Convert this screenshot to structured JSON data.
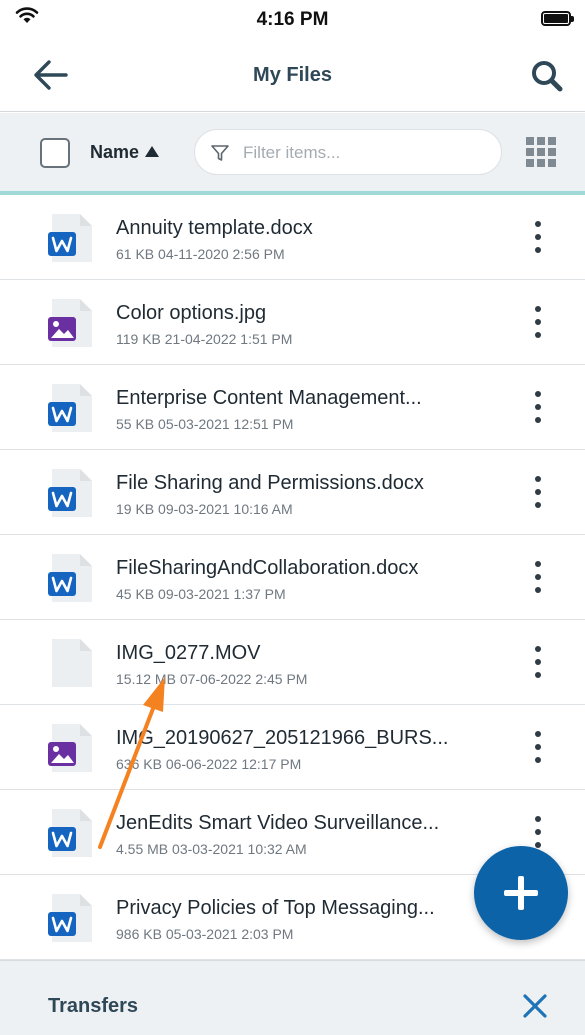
{
  "status_bar": {
    "time": "4:16 PM"
  },
  "header": {
    "title": "My Files"
  },
  "toolbar": {
    "sort_label": "Name",
    "filter_placeholder": "Filter items..."
  },
  "files": [
    {
      "name": "Annuity template.docx",
      "meta": "61 KB 04-11-2020 2:56 PM",
      "icon": "word-doc-icon"
    },
    {
      "name": "Color options.jpg",
      "meta": "119 KB 21-04-2022 1:51 PM",
      "icon": "image-file-icon"
    },
    {
      "name": "Enterprise Content Management...",
      "meta": "55 KB 05-03-2021 12:51 PM",
      "icon": "word-doc-icon"
    },
    {
      "name": "File Sharing and Permissions.docx",
      "meta": "19 KB 09-03-2021 10:16 AM",
      "icon": "word-doc-icon"
    },
    {
      "name": "FileSharingAndCollaboration.docx",
      "meta": "45 KB 09-03-2021 1:37 PM",
      "icon": "word-doc-icon"
    },
    {
      "name": "IMG_0277.MOV",
      "meta": "15.12 MB 07-06-2022 2:45 PM",
      "icon": "generic-file-icon"
    },
    {
      "name": "IMG_20190627_205121966_BURS...",
      "meta": "636 KB 06-06-2022 12:17 PM",
      "icon": "image-file-icon"
    },
    {
      "name": "JenEdits Smart Video Surveillance...",
      "meta": "4.55 MB 03-03-2021 10:32 AM",
      "icon": "word-doc-icon"
    },
    {
      "name": "Privacy Policies of Top Messaging...",
      "meta": "986 KB 05-03-2021 2:03 PM",
      "icon": "word-doc-icon"
    }
  ],
  "footer": {
    "transfers_label": "Transfers"
  },
  "colors": {
    "brand_blue": "#0c63a8",
    "word_blue": "#1565c0",
    "image_purple": "#6a2fa0",
    "accent_teal": "#9fdad9",
    "annotation_orange": "#f58220"
  }
}
